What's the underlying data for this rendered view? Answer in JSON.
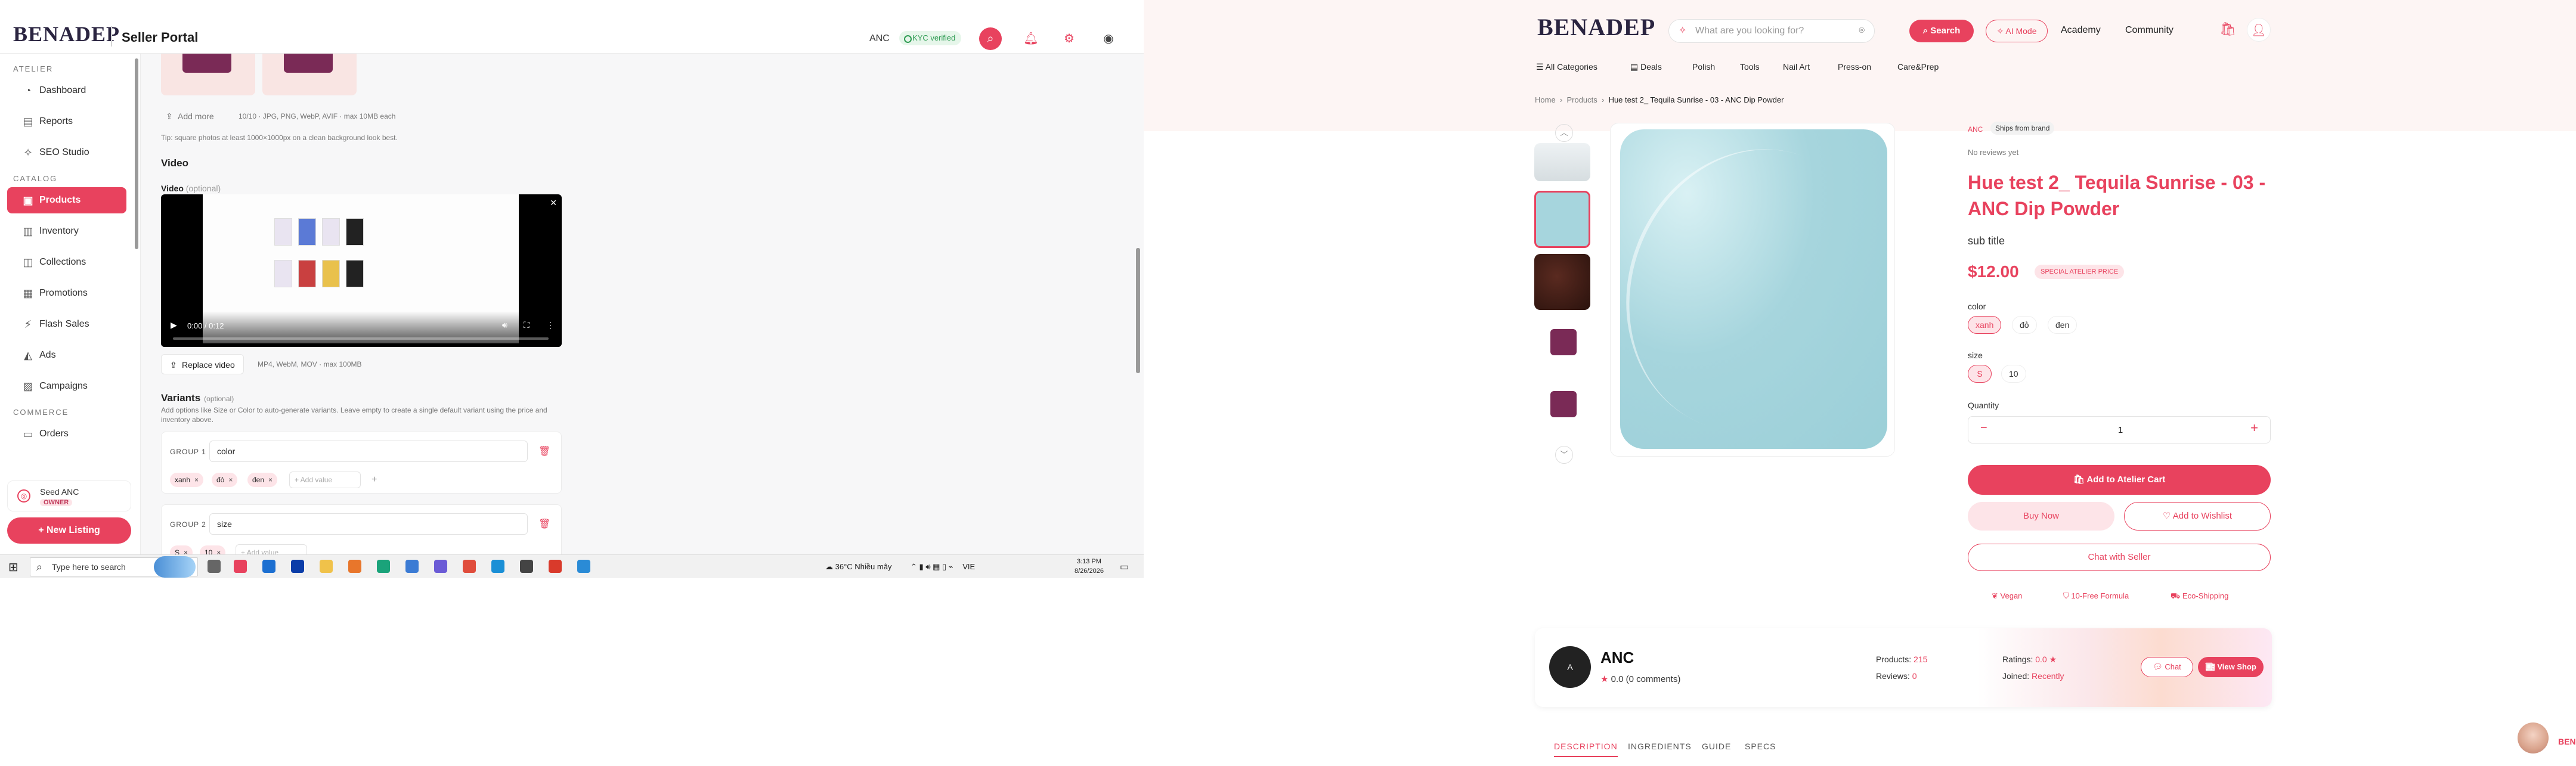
{
  "seller_portal": {
    "logo": "BENADEP",
    "portal_title": "Seller Portal",
    "store_code": "ANC",
    "kyc_badge": "KYC verified",
    "sidebar": {
      "sections": [
        {
          "label": "ATELIER",
          "items": [
            {
              "label": "Dashboard",
              "icon": "dashboard-icon"
            },
            {
              "label": "Reports",
              "icon": "reports-icon"
            },
            {
              "label": "SEO Studio",
              "icon": "seo-icon"
            }
          ]
        },
        {
          "label": "CATALOG",
          "items": [
            {
              "label": "Products",
              "icon": "products-icon",
              "active": true
            },
            {
              "label": "Inventory",
              "icon": "inventory-icon"
            },
            {
              "label": "Collections",
              "icon": "collections-icon"
            },
            {
              "label": "Promotions",
              "icon": "promotions-icon"
            },
            {
              "label": "Flash Sales",
              "icon": "flash-icon"
            },
            {
              "label": "Ads",
              "icon": "ads-icon"
            },
            {
              "label": "Campaigns",
              "icon": "campaigns-icon"
            }
          ]
        },
        {
          "label": "COMMERCE",
          "items": [
            {
              "label": "Orders",
              "icon": "orders-icon"
            }
          ]
        }
      ],
      "owner_name": "Seed ANC",
      "owner_role": "OWNER",
      "new_listing": "+ New Listing"
    },
    "form": {
      "add_more": "Add more",
      "add_more_hint": "10/10 · JPG, PNG, WebP, AVIF · max 10MB each",
      "photo_tip": "Tip: square photos at least 1000×1000px on a clean background look best.",
      "video_heading": "Video",
      "video_label": "Video",
      "video_optional": "(optional)",
      "video_time": "0:00 / 0:12",
      "video_progress": 0.0,
      "replace_video": "Replace video",
      "replace_hint": "MP4, WebM, MOV · max 100MB",
      "variants_heading": "Variants",
      "variants_optional": "(optional)",
      "variants_desc": "Add options like Size or Color to auto-generate variants. Leave empty to create a single default variant using the price and inventory above.",
      "groups": [
        {
          "label": "GROUP 1",
          "name": "color",
          "values": [
            "xanh",
            "đỏ",
            "đen"
          ],
          "add_placeholder": "+ Add value"
        },
        {
          "label": "GROUP 2",
          "name": "size",
          "values": [
            "S",
            "10"
          ],
          "add_placeholder": "+ Add value"
        }
      ]
    },
    "taskbar": {
      "search_placeholder": "Type here to search",
      "weather": "36°C  Nhiều mây",
      "lang": "VIE",
      "time": "3:13 PM",
      "date": "8/26/2026"
    }
  },
  "storefront": {
    "logo": "BENADEP",
    "search_placeholder": "What are you looking for?",
    "search_button": "Search",
    "ai_mode": "AI Mode",
    "nav_links": [
      "Academy",
      "Community"
    ],
    "categories": [
      "All Categories",
      "Deals",
      "Polish",
      "Tools",
      "Nail Art",
      "Press-on",
      "Care&Prep"
    ],
    "breadcrumb": [
      "Home",
      "Products",
      "Hue test 2_ Tequila Sunrise - 03 - ANC Dip Powder"
    ],
    "product": {
      "brand": "ANC",
      "ships_badge": "Ships from brand",
      "reviews": "No reviews yet",
      "title": "Hue test 2_ Tequila Sunrise - 03 - ANC Dip Powder",
      "subtitle": "sub title",
      "price": "$12.00",
      "special_badge": "SPECIAL ATELIER PRICE",
      "color_label": "color",
      "colors": [
        "xanh",
        "đỏ",
        "đen"
      ],
      "selected_color": "xanh",
      "size_label": "size",
      "sizes": [
        "S",
        "10"
      ],
      "selected_size": "S",
      "quantity_label": "Quantity",
      "quantity": "1",
      "add_to_cart": "Add to Atelier Cart",
      "buy_now": "Buy Now",
      "wishlist": "Add to Wishlist",
      "chat_seller": "Chat with Seller",
      "features": [
        "Vegan",
        "10-Free Formula",
        "Eco-Shipping"
      ],
      "swatch_color": "#a6d5dd"
    },
    "store": {
      "avatar": "A",
      "name": "ANC",
      "rating": "0.0 (0 comments)",
      "products_label": "Products:",
      "products_value": "215",
      "reviews_label": "Reviews:",
      "reviews_value": "0",
      "ratings_label": "Ratings:",
      "ratings_value": "0.0 ★",
      "joined_label": "Joined:",
      "joined_value": "Recently",
      "chat": "Chat",
      "view_shop": "View Shop"
    },
    "detail_tabs": [
      "DESCRIPTION",
      "INGREDIENTS",
      "GUIDE",
      "SPECS"
    ],
    "bot_label": "BEN"
  },
  "colors": {
    "accent": "#e8425e",
    "accent_light": "#fde4e8",
    "ink": "#2a2440"
  }
}
